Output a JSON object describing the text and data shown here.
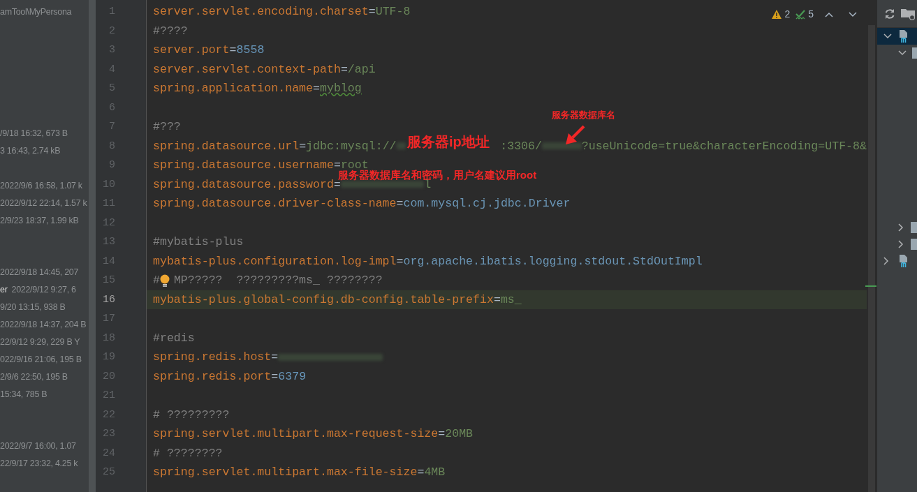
{
  "project_panel": {
    "rows": [
      {
        "parts": [
          {
            "kind": "info",
            "text": "amTool\\MyPersona"
          }
        ]
      },
      {
        "parts": [
          {
            "kind": "info",
            "text": "/9/18 16:32, 673 B"
          }
        ]
      },
      {
        "parts": [
          {
            "kind": "info",
            "text": "3 16:43, 2.74 kB"
          }
        ]
      },
      {
        "parts": [
          {
            "kind": "info",
            "text": "2022/9/6 16:58, 1.07 k"
          }
        ]
      },
      {
        "parts": [
          {
            "kind": "info",
            "text": "2022/9/12 22:14, 1.57 k"
          }
        ]
      },
      {
        "parts": [
          {
            "kind": "info",
            "text": "2/9/23 18:37, 1.99 kB"
          }
        ]
      },
      {
        "parts": [
          {
            "kind": "info",
            "text": "2022/9/18 14:45, 207"
          }
        ]
      },
      {
        "parts": [
          {
            "kind": "name",
            "text": "er"
          },
          {
            "kind": "info",
            "text": "2022/9/12 9:27, 6"
          }
        ]
      },
      {
        "parts": [
          {
            "kind": "info",
            "text": "9/20 13:15, 938 B"
          }
        ]
      },
      {
        "parts": [
          {
            "kind": "info",
            "text": "2022/9/18 14:37, 204 B"
          }
        ]
      },
      {
        "parts": [
          {
            "kind": "info",
            "text": "22/9/12 9:29, 229 B Y"
          }
        ]
      },
      {
        "parts": [
          {
            "kind": "info",
            "text": "022/9/16 21:06, 195 B"
          }
        ]
      },
      {
        "parts": [
          {
            "kind": "info",
            "text": "2/9/6 22:50, 195 B"
          }
        ]
      },
      {
        "parts": [
          {
            "kind": "info",
            "text": "15:34, 785 B"
          }
        ]
      },
      {
        "parts": [
          {
            "kind": "info",
            "text": "2022/9/7 16:00, 1.07"
          }
        ]
      },
      {
        "parts": [
          {
            "kind": "info",
            "text": "22/9/17 23:32, 4.25 k"
          }
        ]
      }
    ]
  },
  "editor": {
    "inspections": {
      "warnings": "2",
      "typos": "5"
    },
    "lines": [
      {
        "number": "1",
        "current": false,
        "segments": [
          {
            "kind": "key",
            "text": "server.servlet.encoding.charset"
          },
          {
            "kind": "sep",
            "text": "="
          },
          {
            "kind": "value",
            "text": "UTF-8"
          }
        ]
      },
      {
        "number": "2",
        "current": false,
        "segments": [
          {
            "kind": "comment",
            "text": "#????"
          }
        ]
      },
      {
        "number": "3",
        "current": false,
        "segments": [
          {
            "kind": "key",
            "text": "server.port"
          },
          {
            "kind": "sep",
            "text": "="
          },
          {
            "kind": "number",
            "text": "8558"
          }
        ]
      },
      {
        "number": "4",
        "current": false,
        "segments": [
          {
            "kind": "key",
            "text": "server.servlet.context-path"
          },
          {
            "kind": "sep",
            "text": "="
          },
          {
            "kind": "value",
            "text": "/api"
          }
        ]
      },
      {
        "number": "5",
        "current": false,
        "segments": [
          {
            "kind": "key",
            "text": "spring.application.name"
          },
          {
            "kind": "sep",
            "text": "="
          },
          {
            "kind": "typo",
            "text": "myblog"
          }
        ]
      },
      {
        "number": "6",
        "current": false
      },
      {
        "number": "7",
        "current": false,
        "segments": [
          {
            "kind": "comment",
            "text": "#???"
          }
        ]
      },
      {
        "number": "8",
        "current": false,
        "segments": [
          {
            "kind": "key",
            "text": "spring.datasource.url"
          },
          {
            "kind": "sep",
            "text": "="
          },
          {
            "kind": "value",
            "text": "jdbc:mysql://"
          },
          {
            "kind": "redacted"
          },
          {
            "kind": "value",
            "text": ":3306/"
          },
          {
            "kind": "redacted"
          },
          {
            "kind": "value",
            "text": "?useUnicode=true&characterEncoding=UTF-8&"
          }
        ]
      },
      {
        "number": "9",
        "current": false,
        "segments": [
          {
            "kind": "key",
            "text": "spring.datasource.username"
          },
          {
            "kind": "sep",
            "text": "="
          },
          {
            "kind": "value",
            "text": "root"
          }
        ]
      },
      {
        "number": "10",
        "current": false,
        "segments": [
          {
            "kind": "key",
            "text": "spring.datasource.password"
          },
          {
            "kind": "sep",
            "text": "="
          },
          {
            "kind": "redacted"
          },
          {
            "kind": "value",
            "text": "l"
          }
        ]
      },
      {
        "number": "11",
        "current": false,
        "segments": [
          {
            "kind": "key",
            "text": "spring.datasource.driver-class-name"
          },
          {
            "kind": "sep",
            "text": "="
          },
          {
            "kind": "class",
            "text": "com.mysql.cj.jdbc.Driver"
          }
        ]
      },
      {
        "number": "12",
        "current": false
      },
      {
        "number": "13",
        "current": false,
        "segments": [
          {
            "kind": "comment",
            "text": "#mybatis-plus"
          }
        ]
      },
      {
        "number": "14",
        "current": false,
        "segments": [
          {
            "kind": "key",
            "text": "mybatis-plus.configuration.log-impl"
          },
          {
            "kind": "sep",
            "text": "="
          },
          {
            "kind": "class",
            "text": "org.apache.ibatis.logging.stdout.StdOutImpl"
          }
        ]
      },
      {
        "number": "15",
        "current": false,
        "segments": [
          {
            "kind": "comment",
            "text": "#"
          },
          {
            "kind": "bulb"
          },
          {
            "kind": "comment",
            "text": "MP?????  ?????????ms_ ????????"
          }
        ]
      },
      {
        "number": "16",
        "current": true,
        "segments": [
          {
            "kind": "key",
            "text": "mybatis-plus.global-config.db-config.table-prefix"
          },
          {
            "kind": "sep",
            "text": "="
          },
          {
            "kind": "value",
            "text": "ms_"
          }
        ]
      },
      {
        "number": "17",
        "current": false
      },
      {
        "number": "18",
        "current": false,
        "segments": [
          {
            "kind": "comment",
            "text": "#redis"
          }
        ]
      },
      {
        "number": "19",
        "current": false,
        "segments": [
          {
            "kind": "key",
            "text": "spring.redis.host"
          },
          {
            "kind": "sep",
            "text": "="
          },
          {
            "kind": "redacted"
          }
        ]
      },
      {
        "number": "20",
        "current": false,
        "segments": [
          {
            "kind": "key",
            "text": "spring.redis.port"
          },
          {
            "kind": "sep",
            "text": "="
          },
          {
            "kind": "number",
            "text": "6379"
          }
        ]
      },
      {
        "number": "21",
        "current": false
      },
      {
        "number": "22",
        "current": false,
        "segments": [
          {
            "kind": "comment",
            "text": "# ?????????"
          }
        ]
      },
      {
        "number": "23",
        "current": false,
        "segments": [
          {
            "kind": "key",
            "text": "spring.servlet.multipart.max-request-size"
          },
          {
            "kind": "sep",
            "text": "="
          },
          {
            "kind": "value",
            "text": "20MB"
          }
        ]
      },
      {
        "number": "24",
        "current": false,
        "segments": [
          {
            "kind": "comment",
            "text": "# ????????"
          }
        ]
      },
      {
        "number": "25",
        "current": false,
        "segments": [
          {
            "kind": "key",
            "text": "spring.servlet.multipart.max-file-size"
          },
          {
            "kind": "sep",
            "text": "="
          },
          {
            "kind": "value",
            "text": "4MB"
          }
        ]
      }
    ]
  },
  "annotations": [
    {
      "text": "服务器数据库名"
    },
    {
      "text": "服务器ip地址"
    },
    {
      "text": "服务器数据库名和密码，用户名建议用root"
    }
  ],
  "structure_panel": {
    "items": [
      {
        "kind": "module",
        "expanded": true,
        "selected": true,
        "children": [
          {
            "kind": "folder",
            "expanded": true,
            "selected": false
          },
          {
            "kind": "folder",
            "expanded": false,
            "selected": false
          },
          {
            "kind": "folder",
            "expanded": false,
            "selected": false
          }
        ]
      },
      {
        "kind": "module",
        "expanded": false,
        "selected": false
      }
    ]
  }
}
